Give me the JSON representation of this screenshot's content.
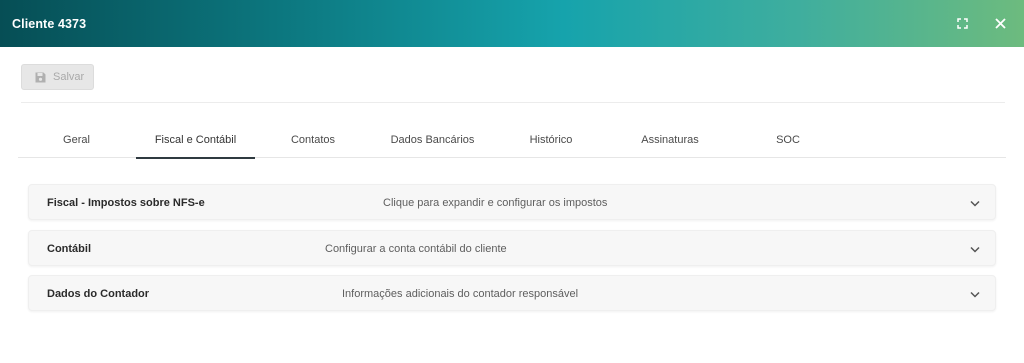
{
  "window": {
    "title": "Cliente 4373",
    "maximize_icon": "fullscreen-icon",
    "close_icon": "close-icon"
  },
  "toolbar": {
    "save_label": "Salvar",
    "save_icon": "floppy-disk-icon",
    "save_disabled": true
  },
  "tabs": [
    {
      "label": "Geral",
      "active": false
    },
    {
      "label": "Fiscal e Contábil",
      "active": true
    },
    {
      "label": "Contatos",
      "active": false
    },
    {
      "label": "Dados Bancários",
      "active": false
    },
    {
      "label": "Histórico",
      "active": false
    },
    {
      "label": "Assinaturas",
      "active": false
    },
    {
      "label": "SOC",
      "active": false
    }
  ],
  "panels": [
    {
      "title": "Fiscal - Impostos sobre NFS-e",
      "description": "Clique para expandir e configurar os impostos",
      "expanded": false
    },
    {
      "title": "Contábil",
      "description": "Configurar a conta contábil do cliente",
      "expanded": false
    },
    {
      "title": "Dados do Contador",
      "description": "Informações adicionais do contador responsável",
      "expanded": false
    }
  ],
  "colors": {
    "header_gradient_start": "#064e55",
    "header_gradient_end": "#6dbb7e",
    "active_tab_underline": "#2f3a40"
  }
}
